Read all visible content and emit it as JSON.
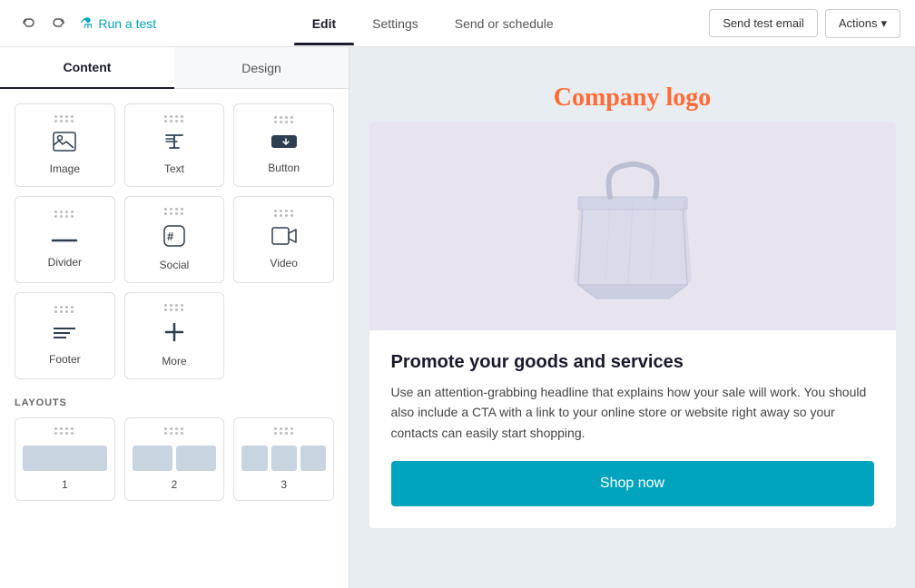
{
  "navbar": {
    "undo_label": "↩",
    "redo_label": "↪",
    "run_test_label": "Run a test",
    "tabs": [
      {
        "id": "edit",
        "label": "Edit",
        "active": true
      },
      {
        "id": "settings",
        "label": "Settings",
        "active": false
      },
      {
        "id": "send_or_schedule",
        "label": "Send or schedule",
        "active": false
      }
    ],
    "send_test_email_label": "Send test email",
    "actions_label": "Actions",
    "actions_arrow": "▾"
  },
  "left_panel": {
    "tabs": [
      {
        "id": "content",
        "label": "Content",
        "active": true
      },
      {
        "id": "design",
        "label": "Design",
        "active": false
      }
    ],
    "blocks": [
      {
        "id": "image",
        "label": "Image",
        "icon": "🖼"
      },
      {
        "id": "text",
        "label": "Text",
        "icon": "📝"
      },
      {
        "id": "button",
        "label": "Button",
        "icon": "🖱"
      },
      {
        "id": "divider",
        "label": "Divider",
        "icon": "—"
      },
      {
        "id": "social",
        "label": "Social",
        "icon": "💬"
      },
      {
        "id": "video",
        "label": "Video",
        "icon": "🎬"
      },
      {
        "id": "footer",
        "label": "Footer",
        "icon": "≡"
      },
      {
        "id": "more",
        "label": "More",
        "icon": "+"
      }
    ],
    "layouts_title": "LAYOUTS",
    "layouts": [
      {
        "id": "1",
        "label": "1",
        "cols": 1
      },
      {
        "id": "2",
        "label": "2",
        "cols": 2
      },
      {
        "id": "3",
        "label": "3",
        "cols": 3
      }
    ]
  },
  "preview": {
    "company_logo": "Company logo",
    "headline": "Promote your goods and services",
    "body_text": "Use an attention-grabbing headline that explains how your sale will work. You should also include a CTA with a link to your online store or website right away so your contacts can easily start shopping.",
    "cta_label": "Shop now"
  },
  "colors": {
    "logo_orange": "#ff6b35",
    "cta_teal": "#00a4bd",
    "product_bg": "#e8e4ef"
  }
}
